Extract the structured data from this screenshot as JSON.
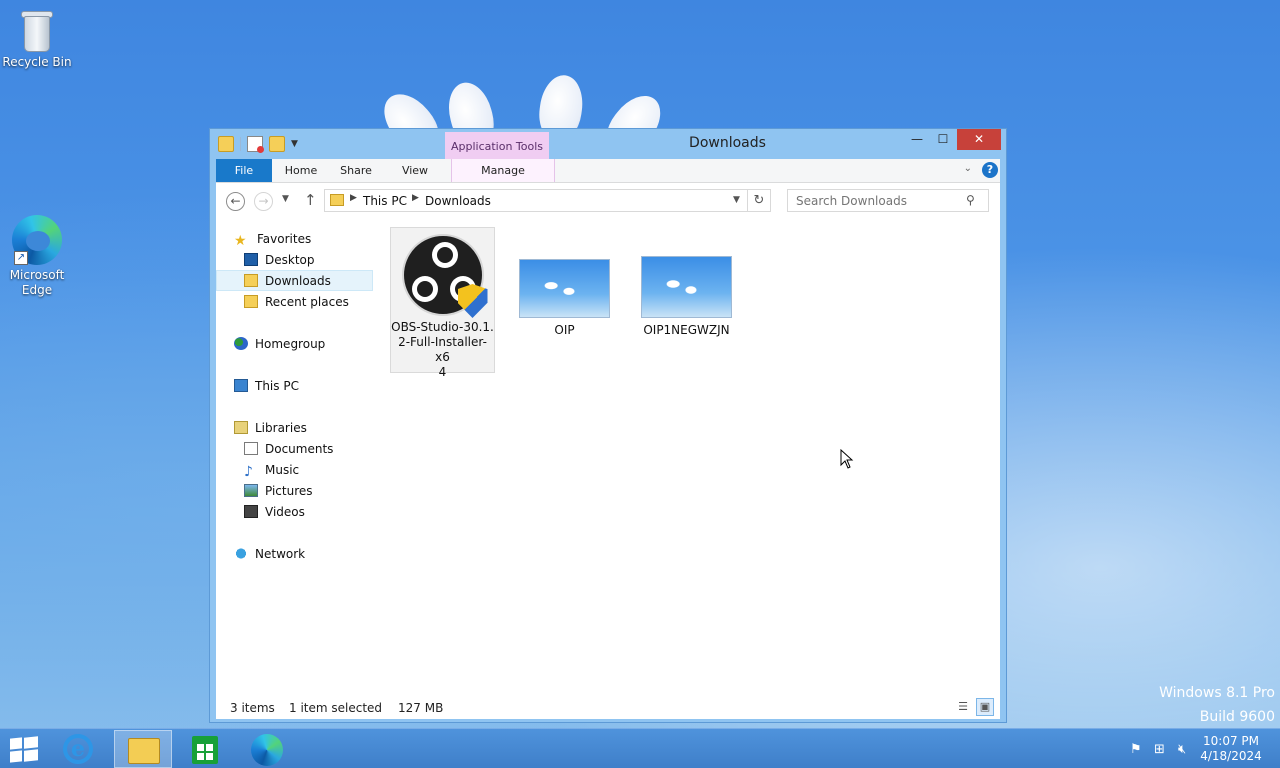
{
  "desktop": {
    "icons": [
      {
        "label": "Recycle Bin",
        "icon": "recycle-bin-icon"
      },
      {
        "label": "Microsoft Edge",
        "icon": "edge-icon"
      }
    ],
    "watermark_line1": "Windows 8.1 Pro",
    "watermark_line2": "Build 9600"
  },
  "window": {
    "title": "Downloads",
    "context_tab_group": "Application Tools",
    "ribbon_tabs": [
      "File",
      "Home",
      "Share",
      "View",
      "Manage"
    ],
    "close_glyph": "✕",
    "minimize_glyph": "—",
    "maximize_glyph": "☐",
    "address": {
      "crumbs": [
        "This PC",
        "Downloads"
      ]
    },
    "search": {
      "placeholder": "Search Downloads"
    },
    "nav": {
      "favorites": "Favorites",
      "desktop": "Desktop",
      "downloads": "Downloads",
      "recent_places": "Recent places",
      "homegroup": "Homegroup",
      "this_pc": "This PC",
      "libraries": "Libraries",
      "documents": "Documents",
      "music": "Music",
      "pictures": "Pictures",
      "videos": "Videos",
      "network": "Network"
    },
    "files": [
      {
        "name": "OBS-Studio-30.1.2-Full-Installer-x64",
        "name_lines": [
          "OBS-Studio-30.1.",
          "2-Full-Installer-x6",
          "4"
        ],
        "type": "installer",
        "selected": true
      },
      {
        "name": "OIP",
        "type": "image",
        "selected": false
      },
      {
        "name": "OIP1NEGWZJN",
        "type": "image",
        "selected": false
      }
    ],
    "status": {
      "item_count": "3 items",
      "selection": "1 item selected",
      "size": "127 MB"
    }
  },
  "taskbar": {
    "apps": [
      "Internet Explorer",
      "File Explorer",
      "Store",
      "Microsoft Edge"
    ],
    "clock_time": "10:07 PM",
    "clock_date": "4/18/2024"
  },
  "colors": {
    "accent": "#1979ca",
    "close": "#c7413a",
    "context_tab": "#f0cdf2"
  }
}
